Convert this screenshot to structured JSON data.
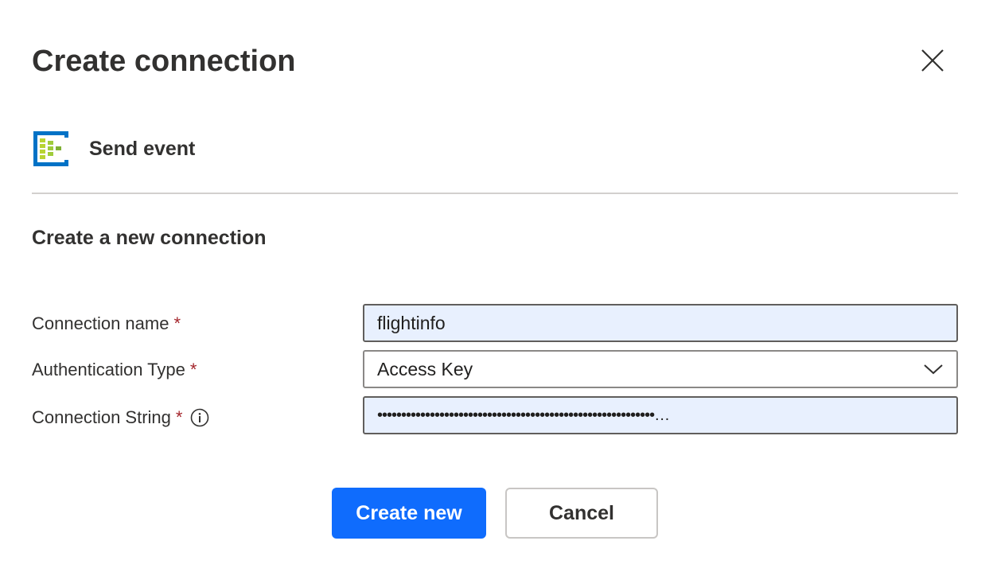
{
  "dialog": {
    "title": "Create connection",
    "close_icon": "close-icon"
  },
  "connector": {
    "icon": "event-hubs-icon",
    "name": "Send event"
  },
  "section": {
    "title": "Create a new connection"
  },
  "fields": {
    "connection_name": {
      "label": "Connection name",
      "required_mark": "*",
      "value": "flightinfo"
    },
    "auth_type": {
      "label": "Authentication Type",
      "required_mark": "*",
      "value": "Access Key",
      "chevron_icon": "chevron-down-icon"
    },
    "connection_string": {
      "label": "Connection String",
      "required_mark": "*",
      "info_icon": "info-icon",
      "value": "••••••••••••••••••••••••••••••••••••••••••••••••••••••••••…"
    }
  },
  "buttons": {
    "create_label": "Create new",
    "cancel_label": "Cancel"
  },
  "colors": {
    "primary": "#0f6cfd",
    "required": "#a4262c",
    "autofill_bg": "#e8f0fe",
    "icon_blue": "#0072c6",
    "icon_green": "#9fcc3b"
  }
}
